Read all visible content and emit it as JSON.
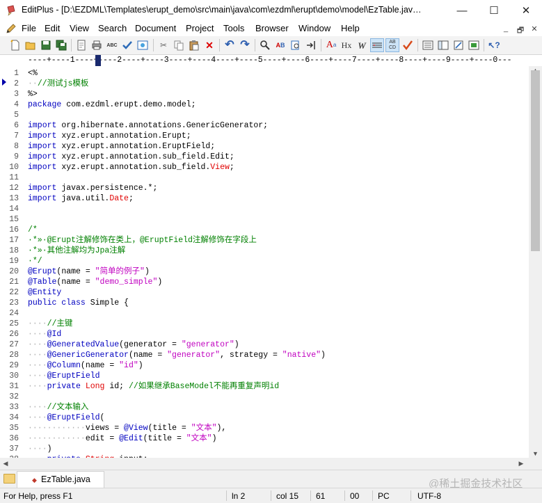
{
  "window": {
    "title": "EditPlus - [D:\\EZDML\\Templates\\erupt_demo\\src\\main\\java\\com\\ezdml\\erupt\\demo\\model\\EzTable.jav…",
    "minimize_label": "—",
    "maximize_label": "☐",
    "close_label": "✕"
  },
  "menu": {
    "items": [
      "File",
      "Edit",
      "View",
      "Search",
      "Document",
      "Project",
      "Tools",
      "Browser",
      "Window",
      "Help"
    ],
    "mdi_minimize": "_",
    "mdi_restore": "🗗",
    "mdi_close": "✕"
  },
  "toolbar": {
    "icons": [
      "new-file-icon",
      "open-icon",
      "save-icon",
      "save-all-icon",
      "print-preview-icon",
      "print-icon",
      "spell-check-icon",
      "check-mark-icon",
      "browser-preview-icon",
      "cut-icon",
      "copy-icon",
      "paste-icon",
      "delete-icon",
      "undo-icon",
      "redo-icon",
      "find-icon",
      "replace-icon",
      "find-in-files-icon",
      "goto-icon",
      "font-icon",
      "hex-icon",
      "word-wrap-icon",
      "indent-guide-icon",
      "column-select-icon",
      "spell-icon",
      "document-list-icon",
      "cliptext-icon",
      "directory-icon",
      "output-window-icon",
      "whats-this-icon"
    ]
  },
  "ruler": {
    "text": "----+----1----+----2----+----3----+----4----+----5----+----6----+----7----+----8----+----9----+----0---"
  },
  "editor": {
    "current_line": 2,
    "lines": [
      {
        "n": "1",
        "segs": [
          [
            "<%",
            ""
          ]
        ]
      },
      {
        "n": "2",
        "segs": [
          [
            "··",
            "dot"
          ],
          [
            "//测试js模板",
            "cm"
          ]
        ]
      },
      {
        "n": "3",
        "segs": [
          [
            "%>",
            ""
          ]
        ]
      },
      {
        "n": "4",
        "segs": [
          [
            "package",
            "kw"
          ],
          [
            " com.ezdml.erupt.demo.model;",
            ""
          ]
        ]
      },
      {
        "n": "5",
        "segs": []
      },
      {
        "n": "6",
        "segs": [
          [
            "import",
            "kw"
          ],
          [
            " org.hibernate.annotations.GenericGenerator;",
            ""
          ]
        ]
      },
      {
        "n": "7",
        "segs": [
          [
            "import",
            "kw"
          ],
          [
            " xyz.erupt.annotation.Erupt;",
            ""
          ]
        ]
      },
      {
        "n": "8",
        "segs": [
          [
            "import",
            "kw"
          ],
          [
            " xyz.erupt.annotation.EruptField;",
            ""
          ]
        ]
      },
      {
        "n": "9",
        "segs": [
          [
            "import",
            "kw"
          ],
          [
            " xyz.erupt.annotation.sub_field.Edit;",
            ""
          ]
        ]
      },
      {
        "n": "10",
        "segs": [
          [
            "import",
            "kw"
          ],
          [
            " xyz.erupt.annotation.sub_field.",
            ""
          ],
          [
            "View",
            "red"
          ],
          [
            ";",
            ""
          ]
        ]
      },
      {
        "n": "11",
        "segs": []
      },
      {
        "n": "12",
        "segs": [
          [
            "import",
            "kw"
          ],
          [
            " javax.persistence.*;",
            ""
          ]
        ]
      },
      {
        "n": "13",
        "segs": [
          [
            "import",
            "kw"
          ],
          [
            " java.util.",
            ""
          ],
          [
            "Date",
            "red"
          ],
          [
            ";",
            ""
          ]
        ]
      },
      {
        "n": "14",
        "segs": []
      },
      {
        "n": "15",
        "segs": []
      },
      {
        "n": "16",
        "segs": [
          [
            "/*",
            "cm"
          ]
        ]
      },
      {
        "n": "17",
        "segs": [
          [
            "·*»·@Erupt注解修饰在类上，@EruptField注解修饰在字段上",
            "cm"
          ]
        ]
      },
      {
        "n": "18",
        "segs": [
          [
            "·*»·其他注解均为Jpa注解",
            "cm"
          ]
        ]
      },
      {
        "n": "19",
        "segs": [
          [
            "·*/",
            "cm"
          ]
        ]
      },
      {
        "n": "20",
        "segs": [
          [
            "@Erupt",
            "kw"
          ],
          [
            "(name = ",
            ""
          ],
          [
            "\"简单的例子\"",
            "str"
          ],
          [
            ")",
            ""
          ]
        ]
      },
      {
        "n": "21",
        "segs": [
          [
            "@Table",
            "kw"
          ],
          [
            "(name = ",
            ""
          ],
          [
            "\"demo_simple\"",
            "str"
          ],
          [
            ")",
            ""
          ]
        ]
      },
      {
        "n": "22",
        "segs": [
          [
            "@Entity",
            "kw"
          ]
        ]
      },
      {
        "n": "23",
        "segs": [
          [
            "public class",
            "kw"
          ],
          [
            " Simple {",
            ""
          ]
        ]
      },
      {
        "n": "24",
        "segs": []
      },
      {
        "n": "25",
        "segs": [
          [
            "····",
            "dot"
          ],
          [
            "//主键",
            "cm"
          ]
        ]
      },
      {
        "n": "26",
        "segs": [
          [
            "····",
            "dot"
          ],
          [
            "@Id",
            "kw"
          ]
        ]
      },
      {
        "n": "27",
        "segs": [
          [
            "····",
            "dot"
          ],
          [
            "@GeneratedValue",
            "kw"
          ],
          [
            "(generator = ",
            ""
          ],
          [
            "\"generator\"",
            "str"
          ],
          [
            ")",
            ""
          ]
        ]
      },
      {
        "n": "28",
        "segs": [
          [
            "····",
            "dot"
          ],
          [
            "@GenericGenerator",
            "kw"
          ],
          [
            "(name = ",
            ""
          ],
          [
            "\"generator\"",
            "str"
          ],
          [
            ", strategy = ",
            ""
          ],
          [
            "\"native\"",
            "str"
          ],
          [
            ")",
            ""
          ]
        ]
      },
      {
        "n": "29",
        "segs": [
          [
            "····",
            "dot"
          ],
          [
            "@Column",
            "kw"
          ],
          [
            "(name = ",
            ""
          ],
          [
            "\"id\"",
            "str"
          ],
          [
            ")",
            ""
          ]
        ]
      },
      {
        "n": "30",
        "segs": [
          [
            "····",
            "dot"
          ],
          [
            "@EruptField",
            "kw"
          ]
        ]
      },
      {
        "n": "31",
        "segs": [
          [
            "····",
            "dot"
          ],
          [
            "private",
            "kw"
          ],
          [
            " ",
            ""
          ],
          [
            "Long",
            "red"
          ],
          [
            " id; ",
            ""
          ],
          [
            "//如果继承BaseModel不能再重复声明id",
            "cm"
          ]
        ]
      },
      {
        "n": "32",
        "segs": []
      },
      {
        "n": "33",
        "segs": [
          [
            "····",
            "dot"
          ],
          [
            "//文本输入",
            "cm"
          ]
        ]
      },
      {
        "n": "34",
        "segs": [
          [
            "····",
            "dot"
          ],
          [
            "@EruptField",
            "kw"
          ],
          [
            "(",
            ""
          ]
        ]
      },
      {
        "n": "35",
        "segs": [
          [
            "············",
            "dot"
          ],
          [
            "views = ",
            ""
          ],
          [
            "@View",
            "kw"
          ],
          [
            "(title = ",
            ""
          ],
          [
            "\"文本\"",
            "str"
          ],
          [
            "),",
            ""
          ]
        ]
      },
      {
        "n": "36",
        "segs": [
          [
            "············",
            "dot"
          ],
          [
            "edit = ",
            ""
          ],
          [
            "@Edit",
            "kw"
          ],
          [
            "(title = ",
            ""
          ],
          [
            "\"文本\"",
            "str"
          ],
          [
            ")",
            ""
          ]
        ]
      },
      {
        "n": "37",
        "segs": [
          [
            "····",
            "dot"
          ],
          [
            ")",
            ""
          ]
        ]
      },
      {
        "n": "38",
        "segs": [
          [
            "····",
            "dot"
          ],
          [
            "private",
            "kw"
          ],
          [
            " ",
            ""
          ],
          [
            "String",
            "red"
          ],
          [
            " input;",
            ""
          ]
        ]
      }
    ]
  },
  "tabs": {
    "file_tab": "EzTable.java"
  },
  "watermark": "@稀土掘金技术社区",
  "status": {
    "help": "For Help, press F1",
    "line": "ln 2",
    "col": "col 15",
    "code": "61",
    "hex": "00",
    "mode": "PC",
    "encoding": "UTF-8"
  }
}
